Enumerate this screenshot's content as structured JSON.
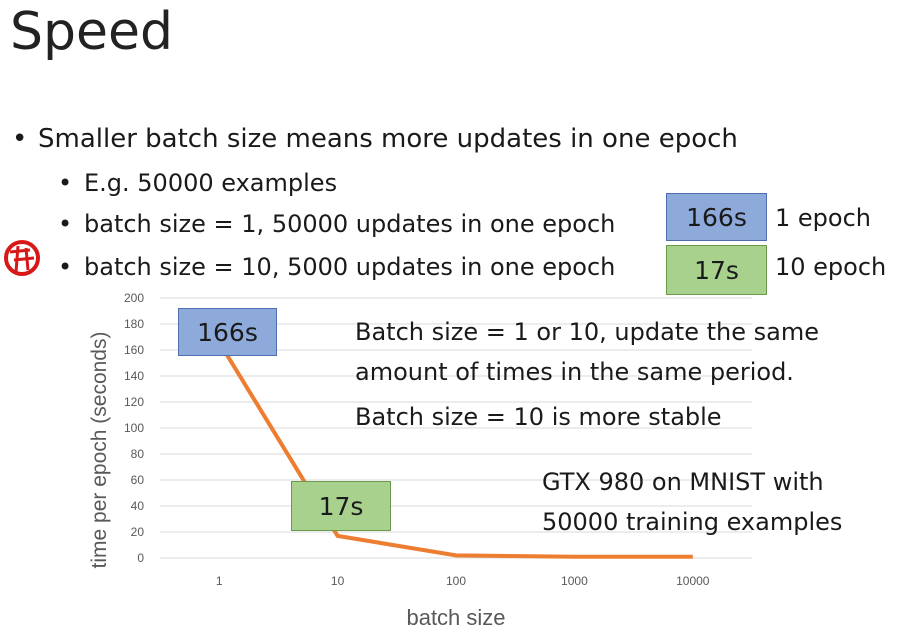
{
  "slide": {
    "title": "Speed",
    "bullet_main": "Smaller batch size means more updates in one epoch",
    "bullet_example": "E.g. 50000 examples",
    "bullet_bs1": "batch size = 1, 50000 updates in one epoch",
    "bullet_bs10": "batch size = 10, 5000 updates in one epoch",
    "box_bs1": "166s",
    "box_bs10": "17s",
    "side_bs1": "1 epoch",
    "side_bs10": "10 epoch",
    "note_line1": "Batch size = 1 or 10, update the same",
    "note_line2": "amount of times in the same period.",
    "note_line3": "Batch size = 10 is more stable",
    "note_gpu1": "GTX 980 on MNIST with",
    "note_gpu2": "50000 training examples",
    "chart_label_166": "166s",
    "chart_label_17": "17s"
  },
  "colors": {
    "line": "#ed7d31",
    "box_blue": "#8eaadb",
    "box_green": "#a9d18e",
    "grid": "#d9d9d9",
    "axis_text": "#595959"
  },
  "chart_data": {
    "type": "line",
    "categories": [
      "1",
      "10",
      "100",
      "1000",
      "10000"
    ],
    "values": [
      166,
      17,
      2,
      1,
      1
    ],
    "xlabel": "batch size",
    "ylabel": "time per epoch (seconds)",
    "ylim": [
      0,
      200
    ],
    "yticks": [
      0,
      20,
      40,
      60,
      80,
      100,
      120,
      140,
      160,
      180,
      200
    ],
    "grid": true
  }
}
